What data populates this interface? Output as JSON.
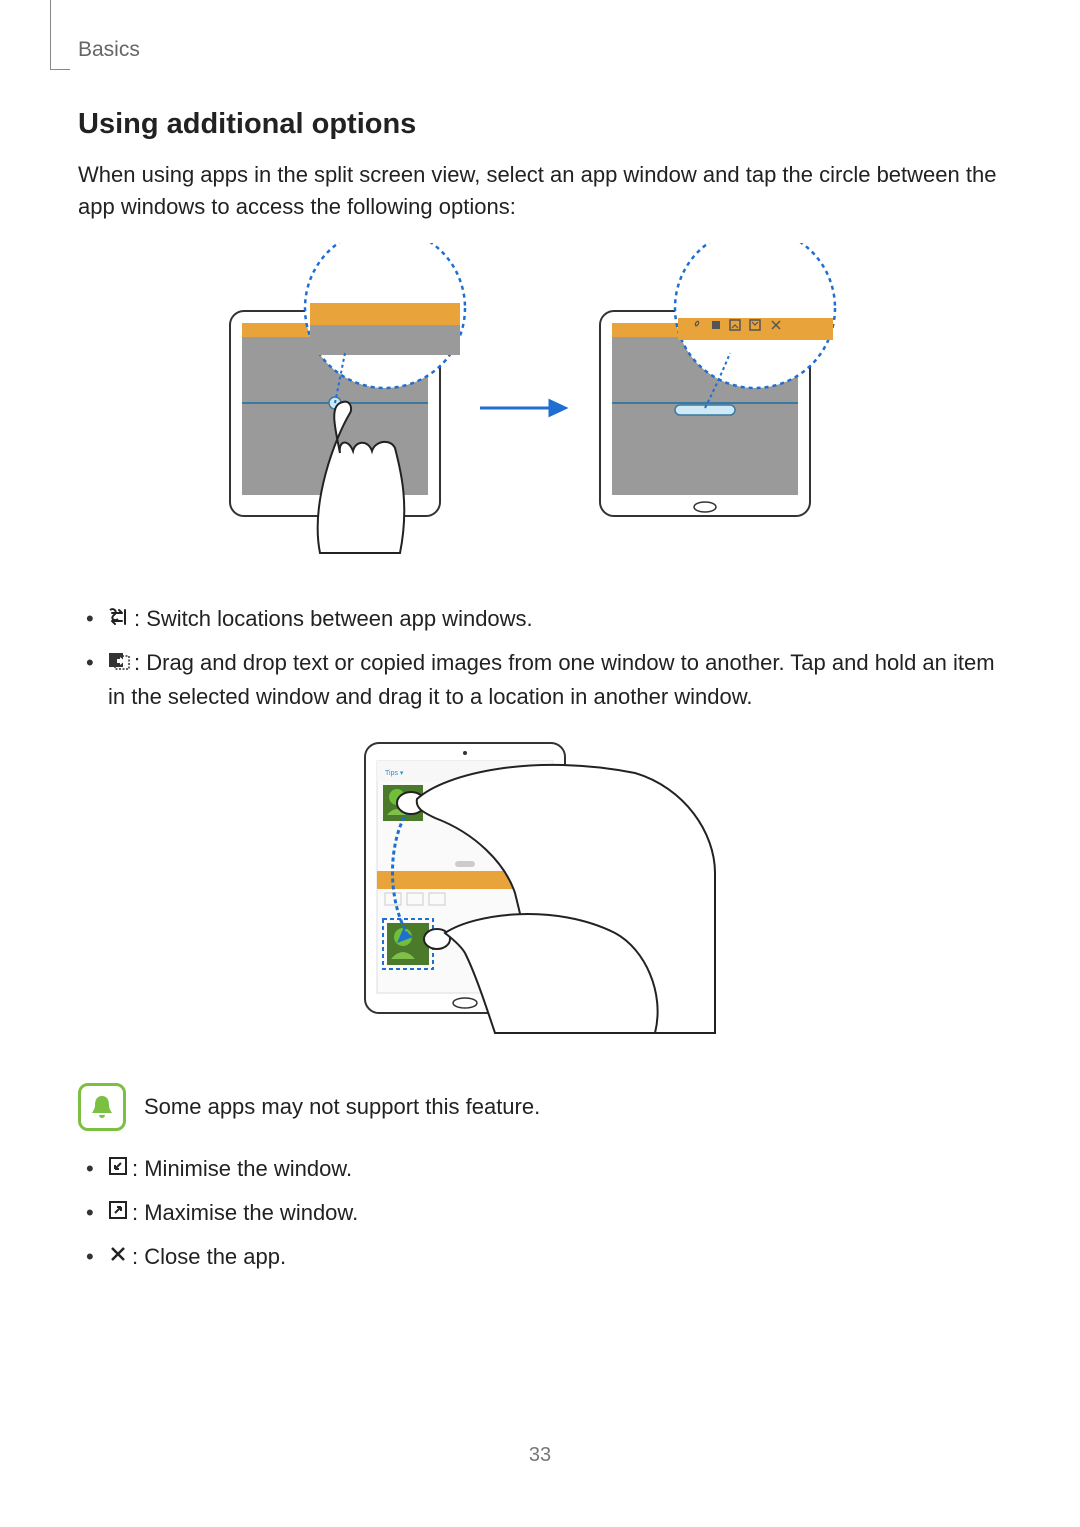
{
  "header": {
    "breadcrumb": "Basics"
  },
  "section": {
    "title": "Using additional options",
    "intro": "When using apps in the split screen view, select an app window and tap the circle between the app windows to access the following options:"
  },
  "list1": [
    {
      "icon": "switch-icon",
      "text": ": Switch locations between app windows."
    },
    {
      "icon": "drag-drop-icon",
      "text": ": Drag and drop text or copied images from one window to another. Tap and hold an item in the selected window and drag it to a location in another window."
    }
  ],
  "note": {
    "text": "Some apps may not support this feature."
  },
  "list2": [
    {
      "icon": "minimise-icon",
      "text": ": Minimise the window."
    },
    {
      "icon": "maximise-icon",
      "text": ": Maximise the window."
    },
    {
      "icon": "close-icon",
      "text": ": Close the app."
    }
  ],
  "page_number": "33"
}
